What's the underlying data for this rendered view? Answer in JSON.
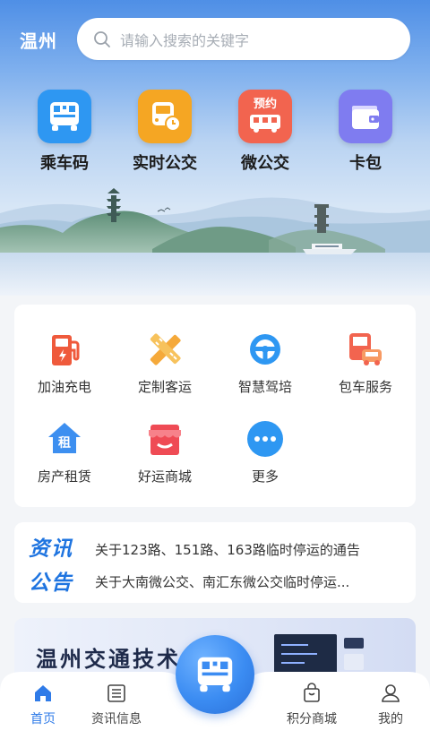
{
  "header": {
    "city": "温州",
    "search_placeholder": "请输入搜索的关键字"
  },
  "quick_actions": [
    {
      "label": "乘车码",
      "icon": "qr-bus-icon",
      "color": "#2e97f2"
    },
    {
      "label": "实时公交",
      "icon": "bus-clock-icon",
      "color": "#f5a623"
    },
    {
      "label": "微公交",
      "icon": "reserve-bus-icon",
      "color": "#f2644f",
      "badge": "预约"
    },
    {
      "label": "卡包",
      "icon": "wallet-icon",
      "color": "#7f7cf0"
    }
  ],
  "services": [
    {
      "label": "加油充电",
      "icon": "fuel-pump-icon",
      "color": "#ef5a3c"
    },
    {
      "label": "定制客运",
      "icon": "pencil-ruler-icon",
      "color": "#f5a93a"
    },
    {
      "label": "智慧驾培",
      "icon": "steering-wheel-icon",
      "color": "#2e97f2"
    },
    {
      "label": "包车服务",
      "icon": "bus-car-icon",
      "color": "#f2644f"
    },
    {
      "label": "房产租赁",
      "icon": "house-rent-icon",
      "color": "#3d8ff0",
      "badge": "租"
    },
    {
      "label": "好运商城",
      "icon": "store-icon",
      "color": "#ef4b55"
    },
    {
      "label": "更多",
      "icon": "more-icon",
      "color": "#2e97f2"
    }
  ],
  "news": {
    "tag_top": "资讯",
    "tag_bottom": "公告",
    "items": [
      "关于123路、151路、163路临时停运的通告",
      "关于大南微公交、南汇东微公交临时停运..."
    ]
  },
  "banner": {
    "title": "温州交通技术"
  },
  "tabbar": {
    "items": [
      {
        "label": "首页",
        "icon": "home-icon",
        "active": true
      },
      {
        "label": "资讯信息",
        "icon": "news-list-icon",
        "active": false
      },
      {
        "label": "积分商城",
        "icon": "shopping-bag-icon",
        "active": false
      },
      {
        "label": "我的",
        "icon": "user-icon",
        "active": false
      }
    ],
    "center_icon": "qr-bus-icon"
  },
  "colors": {
    "accent": "#2f7be8",
    "hero_top": "#4f8fe6"
  }
}
